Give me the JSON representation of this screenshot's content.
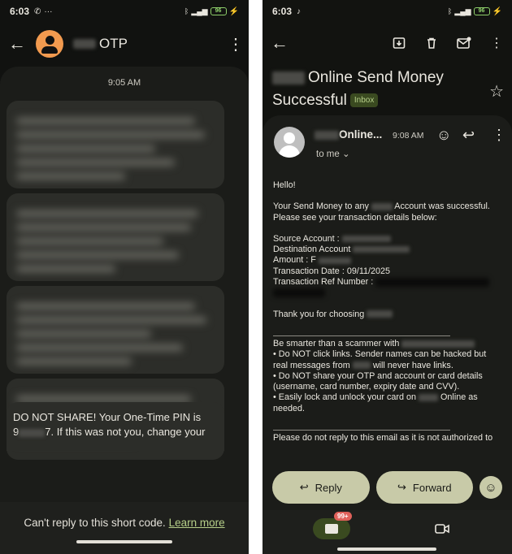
{
  "left": {
    "status": {
      "time": "6:03",
      "battery": "96"
    },
    "header": {
      "title": "OTP"
    },
    "thread": {
      "timestamp": "9:05 AM",
      "last_message_line1": "DO NOT SHARE! Your One-Time PIN is",
      "last_message_prefix": "9",
      "last_message_suffix": "7. If this was not you, change your"
    },
    "footer": {
      "text": "Can't reply to this short code.",
      "link": "Learn more"
    }
  },
  "right": {
    "status": {
      "time": "6:03",
      "battery": "96"
    },
    "subject": {
      "line1": "Online Send Money",
      "line2": "Successful",
      "label": "Inbox"
    },
    "sender": {
      "name": "Online...",
      "time": "9:08 AM",
      "recipient": "to me"
    },
    "body": {
      "greeting": "Hello!",
      "intro_1a": "Your Send Money to any",
      "intro_1b": "Account was successful.",
      "intro_2": "Please see your transaction details below:",
      "source": "Source Account :",
      "destination": "Destination Account",
      "amount": "Amount : F",
      "date": "Transaction Date : 09/11/2025",
      "ref": "Transaction Ref Number :",
      "thanks": "Thank you for choosing",
      "tips_title": "Be smarter than a scammer with",
      "tip1a": "• Do NOT click links. Sender names can be hacked but",
      "tip1b": "real messages from",
      "tip1c": "will never have links.",
      "tip2a": "• Do NOT share your OTP and account or card details",
      "tip2b": "(username, card number, expiry date and CVV).",
      "tip3a": "• Easily lock and unlock your card on",
      "tip3b": "Online as",
      "tip3c": "needed.",
      "footer_note": "Please do not reply to this email as it is not authorized to"
    },
    "actions": {
      "reply": "Reply",
      "forward": "Forward"
    },
    "nav": {
      "badge": "99+"
    }
  }
}
